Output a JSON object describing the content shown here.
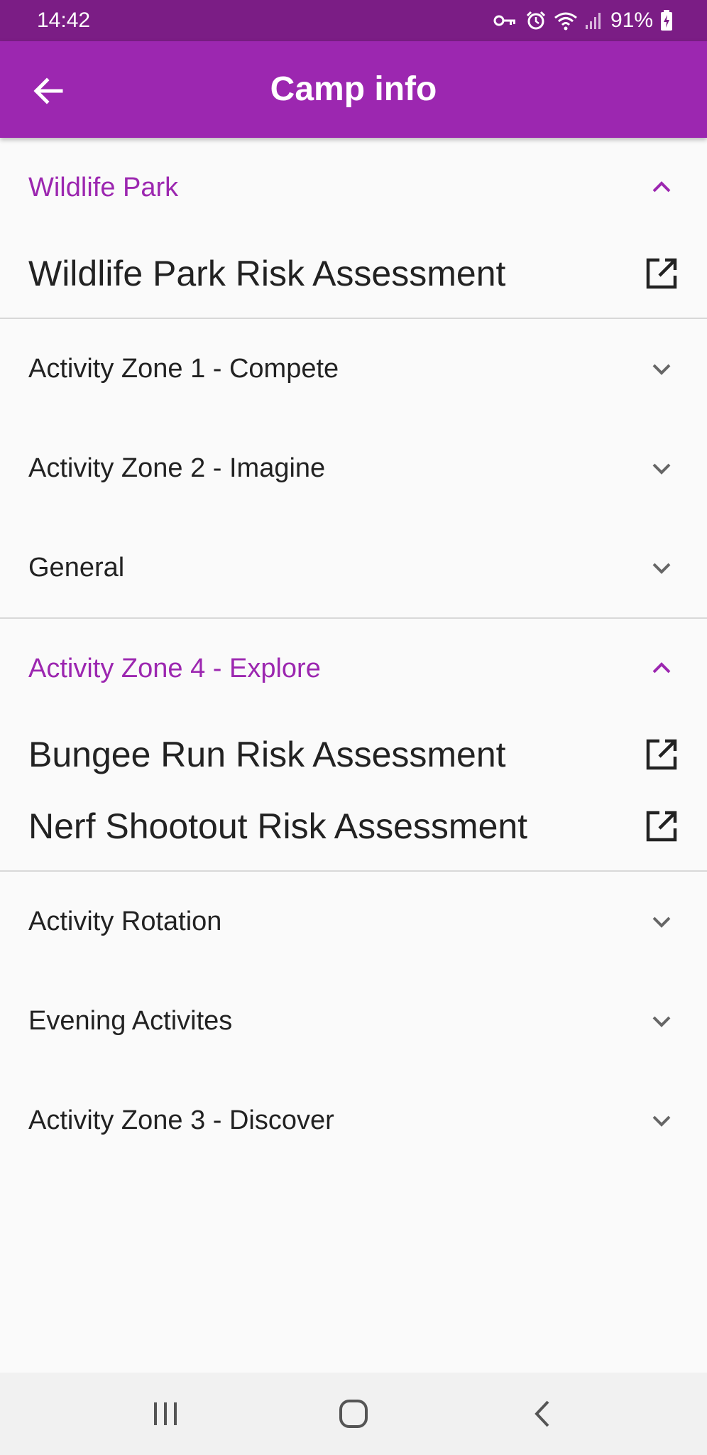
{
  "status_bar": {
    "time": "14:42",
    "battery": "91%",
    "icons": [
      "vpn-key-icon",
      "alarm-icon",
      "wifi-icon",
      "signal-icon",
      "battery-charging-icon"
    ]
  },
  "app_bar": {
    "title": "Camp info",
    "back_icon": "arrow-back-icon"
  },
  "colors": {
    "accent": "#9c27b0",
    "status_bar": "#7b1d85",
    "background": "#fafafa"
  },
  "panels": [
    {
      "title": "Wildlife Park",
      "expanded": true,
      "items": [
        "Wildlife Park Risk Assessment"
      ]
    },
    {
      "title": "Activity Zone 1 - Compete",
      "expanded": false
    },
    {
      "title": "Activity Zone 2 - Imagine",
      "expanded": false
    },
    {
      "title": "General",
      "expanded": false
    },
    {
      "title": "Activity Zone 4 - Explore",
      "expanded": true,
      "items": [
        "Bungee Run Risk Assessment",
        "Nerf Shootout Risk Assessment"
      ]
    },
    {
      "title": "Activity Rotation",
      "expanded": false
    },
    {
      "title": "Evening Activites",
      "expanded": false
    },
    {
      "title": "Activity Zone 3 - Discover",
      "expanded": false
    }
  ],
  "nav_bar": {
    "buttons": [
      "recent-apps-icon",
      "home-icon",
      "back-nav-icon"
    ]
  }
}
